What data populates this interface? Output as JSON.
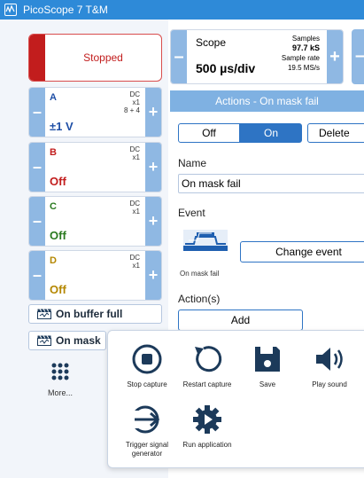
{
  "window": {
    "title": "PicoScope 7 T&M"
  },
  "run_state": {
    "label": "Stopped"
  },
  "channels": [
    {
      "name": "A",
      "coupling": "DC",
      "probe": "x1",
      "extra": "8 + 4",
      "range": "±1 V",
      "color": "#1f4fa6",
      "state": "on"
    },
    {
      "name": "B",
      "coupling": "DC",
      "probe": "x1",
      "extra": "",
      "range": "Off",
      "color": "#c21d1d",
      "state": "off"
    },
    {
      "name": "C",
      "coupling": "DC",
      "probe": "x1",
      "extra": "",
      "range": "Off",
      "color": "#2a7a1f",
      "state": "off"
    },
    {
      "name": "D",
      "coupling": "DC",
      "probe": "x1",
      "extra": "",
      "range": "Off",
      "color": "#b48700",
      "state": "off"
    }
  ],
  "scope": {
    "title": "Scope",
    "timebase": "500 µs/div",
    "samples_label": "Samples",
    "samples_value": "97.7 kS",
    "rate_label": "Sample rate",
    "rate_value": "19.5 MS/s"
  },
  "triggers": {
    "buffer_full": "On buffer full",
    "mask": "On mask"
  },
  "more": {
    "label": "More..."
  },
  "actions": {
    "header": "Actions - On mask fail",
    "off_label": "Off",
    "on_label": "On",
    "selected": "On",
    "delete_label": "Delete",
    "name_label": "Name",
    "name_value": "On mask fail",
    "event_label": "Event",
    "event_caption": "On mask fail",
    "change_event_label": "Change event",
    "actions_label": "Action(s)",
    "add_label": "Add"
  },
  "popup": {
    "items": [
      {
        "label": "Stop capture",
        "icon": "stop-icon"
      },
      {
        "label": "Restart capture",
        "icon": "restart-icon"
      },
      {
        "label": "Save",
        "icon": "save-icon"
      },
      {
        "label": "Play sound",
        "icon": "speaker-icon"
      },
      {
        "label": "Trigger signal generator",
        "icon": "signal-generator-icon"
      },
      {
        "label": "Run application",
        "icon": "gear-icon"
      }
    ]
  },
  "colors": {
    "accent": "#2e74c4",
    "titlebar": "#2e8ad8",
    "stopped": "#c21d1d",
    "stepper": "#8fb8e3",
    "icon": "#1c3a5a"
  }
}
